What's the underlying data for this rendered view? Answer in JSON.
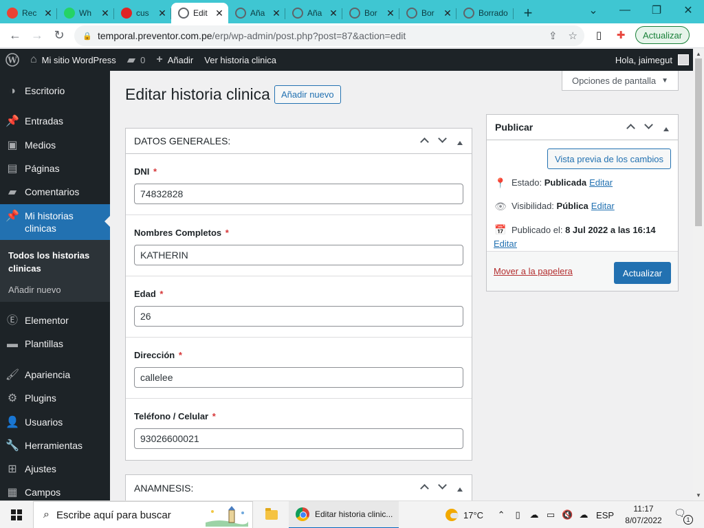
{
  "browser": {
    "tabs": [
      {
        "title": "Rec",
        "icon": "gmail-icon",
        "color": "#ea4335"
      },
      {
        "title": "Wh",
        "icon": "whatsapp-icon",
        "color": "#25d366"
      },
      {
        "title": "cus",
        "icon": "red-w-icon",
        "color": "#e02424"
      },
      {
        "title": "Edit",
        "icon": "globe-icon",
        "color": "#5f6368",
        "active": true
      },
      {
        "title": "Aña",
        "icon": "globe-icon",
        "color": "#5f6368"
      },
      {
        "title": "Aña",
        "icon": "globe-icon",
        "color": "#5f6368"
      },
      {
        "title": "Bor",
        "icon": "globe-icon",
        "color": "#5f6368"
      },
      {
        "title": "Bor",
        "icon": "globe-icon",
        "color": "#5f6368"
      },
      {
        "title": "Borrado",
        "icon": "globe-icon",
        "color": "#5f6368"
      }
    ],
    "url_host": "temporal.preventor.com.pe",
    "url_path": "/erp/wp-admin/post.php?post=87&action=edit",
    "update_label": "Actualizar",
    "accent_color": "#3fc6d2"
  },
  "adminbar": {
    "site_name": "Mi sitio WordPress",
    "comments_count": "0",
    "add_label": "Añadir",
    "view_label": "Ver historia clinica",
    "howdy": "Hola, jaimegut"
  },
  "sidebar": {
    "items": [
      {
        "label": "Escritorio",
        "icon": "dashboard-icon"
      },
      {
        "label": "Entradas",
        "icon": "pin-icon"
      },
      {
        "label": "Medios",
        "icon": "media-icon"
      },
      {
        "label": "Páginas",
        "icon": "pages-icon"
      },
      {
        "label": "Comentarios",
        "icon": "comments-icon"
      },
      {
        "label": "Mi historias clinicas",
        "icon": "pin-icon",
        "current": true
      },
      {
        "label": "Elementor",
        "icon": "elementor-icon"
      },
      {
        "label": "Plantillas",
        "icon": "folder-icon"
      },
      {
        "label": "Apariencia",
        "icon": "brush-icon"
      },
      {
        "label": "Plugins",
        "icon": "plugin-icon"
      },
      {
        "label": "Usuarios",
        "icon": "users-icon"
      },
      {
        "label": "Herramientas",
        "icon": "wrench-icon"
      },
      {
        "label": "Ajustes",
        "icon": "settings-icon"
      },
      {
        "label": "Campos",
        "icon": "fields-icon"
      }
    ],
    "submenu": [
      {
        "label": "Todos los historias clinicas",
        "current": true
      },
      {
        "label": "Añadir nuevo"
      }
    ]
  },
  "screen_options": "Opciones de pantalla",
  "page": {
    "title": "Editar historia clinica",
    "add_new": "Añadir nuevo"
  },
  "general": {
    "title": "DATOS GENERALES:",
    "fields": [
      {
        "label": "DNI",
        "value": "74832828"
      },
      {
        "label": "Nombres Completos",
        "value": "KATHERIN"
      },
      {
        "label": "Edad",
        "value": "26"
      },
      {
        "label": "Dirección",
        "value": "callelee"
      },
      {
        "label": "Teléfono / Celular",
        "value": "93026600021"
      }
    ],
    "required_mark": "*"
  },
  "anamnesis": {
    "title": "ANAMNESIS:"
  },
  "publish": {
    "title": "Publicar",
    "preview_label": "Vista previa de los cambios",
    "status_label": "Estado:",
    "status_value": "Publicada",
    "visibility_label": "Visibilidad:",
    "visibility_value": "Pública",
    "published_label": "Publicado el:",
    "published_value": "8 Jul 2022 a las 16:14",
    "edit_label": "Editar",
    "trash_label": "Mover a la papelera",
    "update_label": "Actualizar",
    "primary_color": "#2271b1"
  },
  "taskbar": {
    "search_placeholder": "Escribe aquí para buscar",
    "chrome_title": "Editar historia clinic...",
    "temperature": "17°C",
    "language": "ESP",
    "time": "11:17",
    "date": "8/07/2022",
    "notification_count": "1"
  }
}
